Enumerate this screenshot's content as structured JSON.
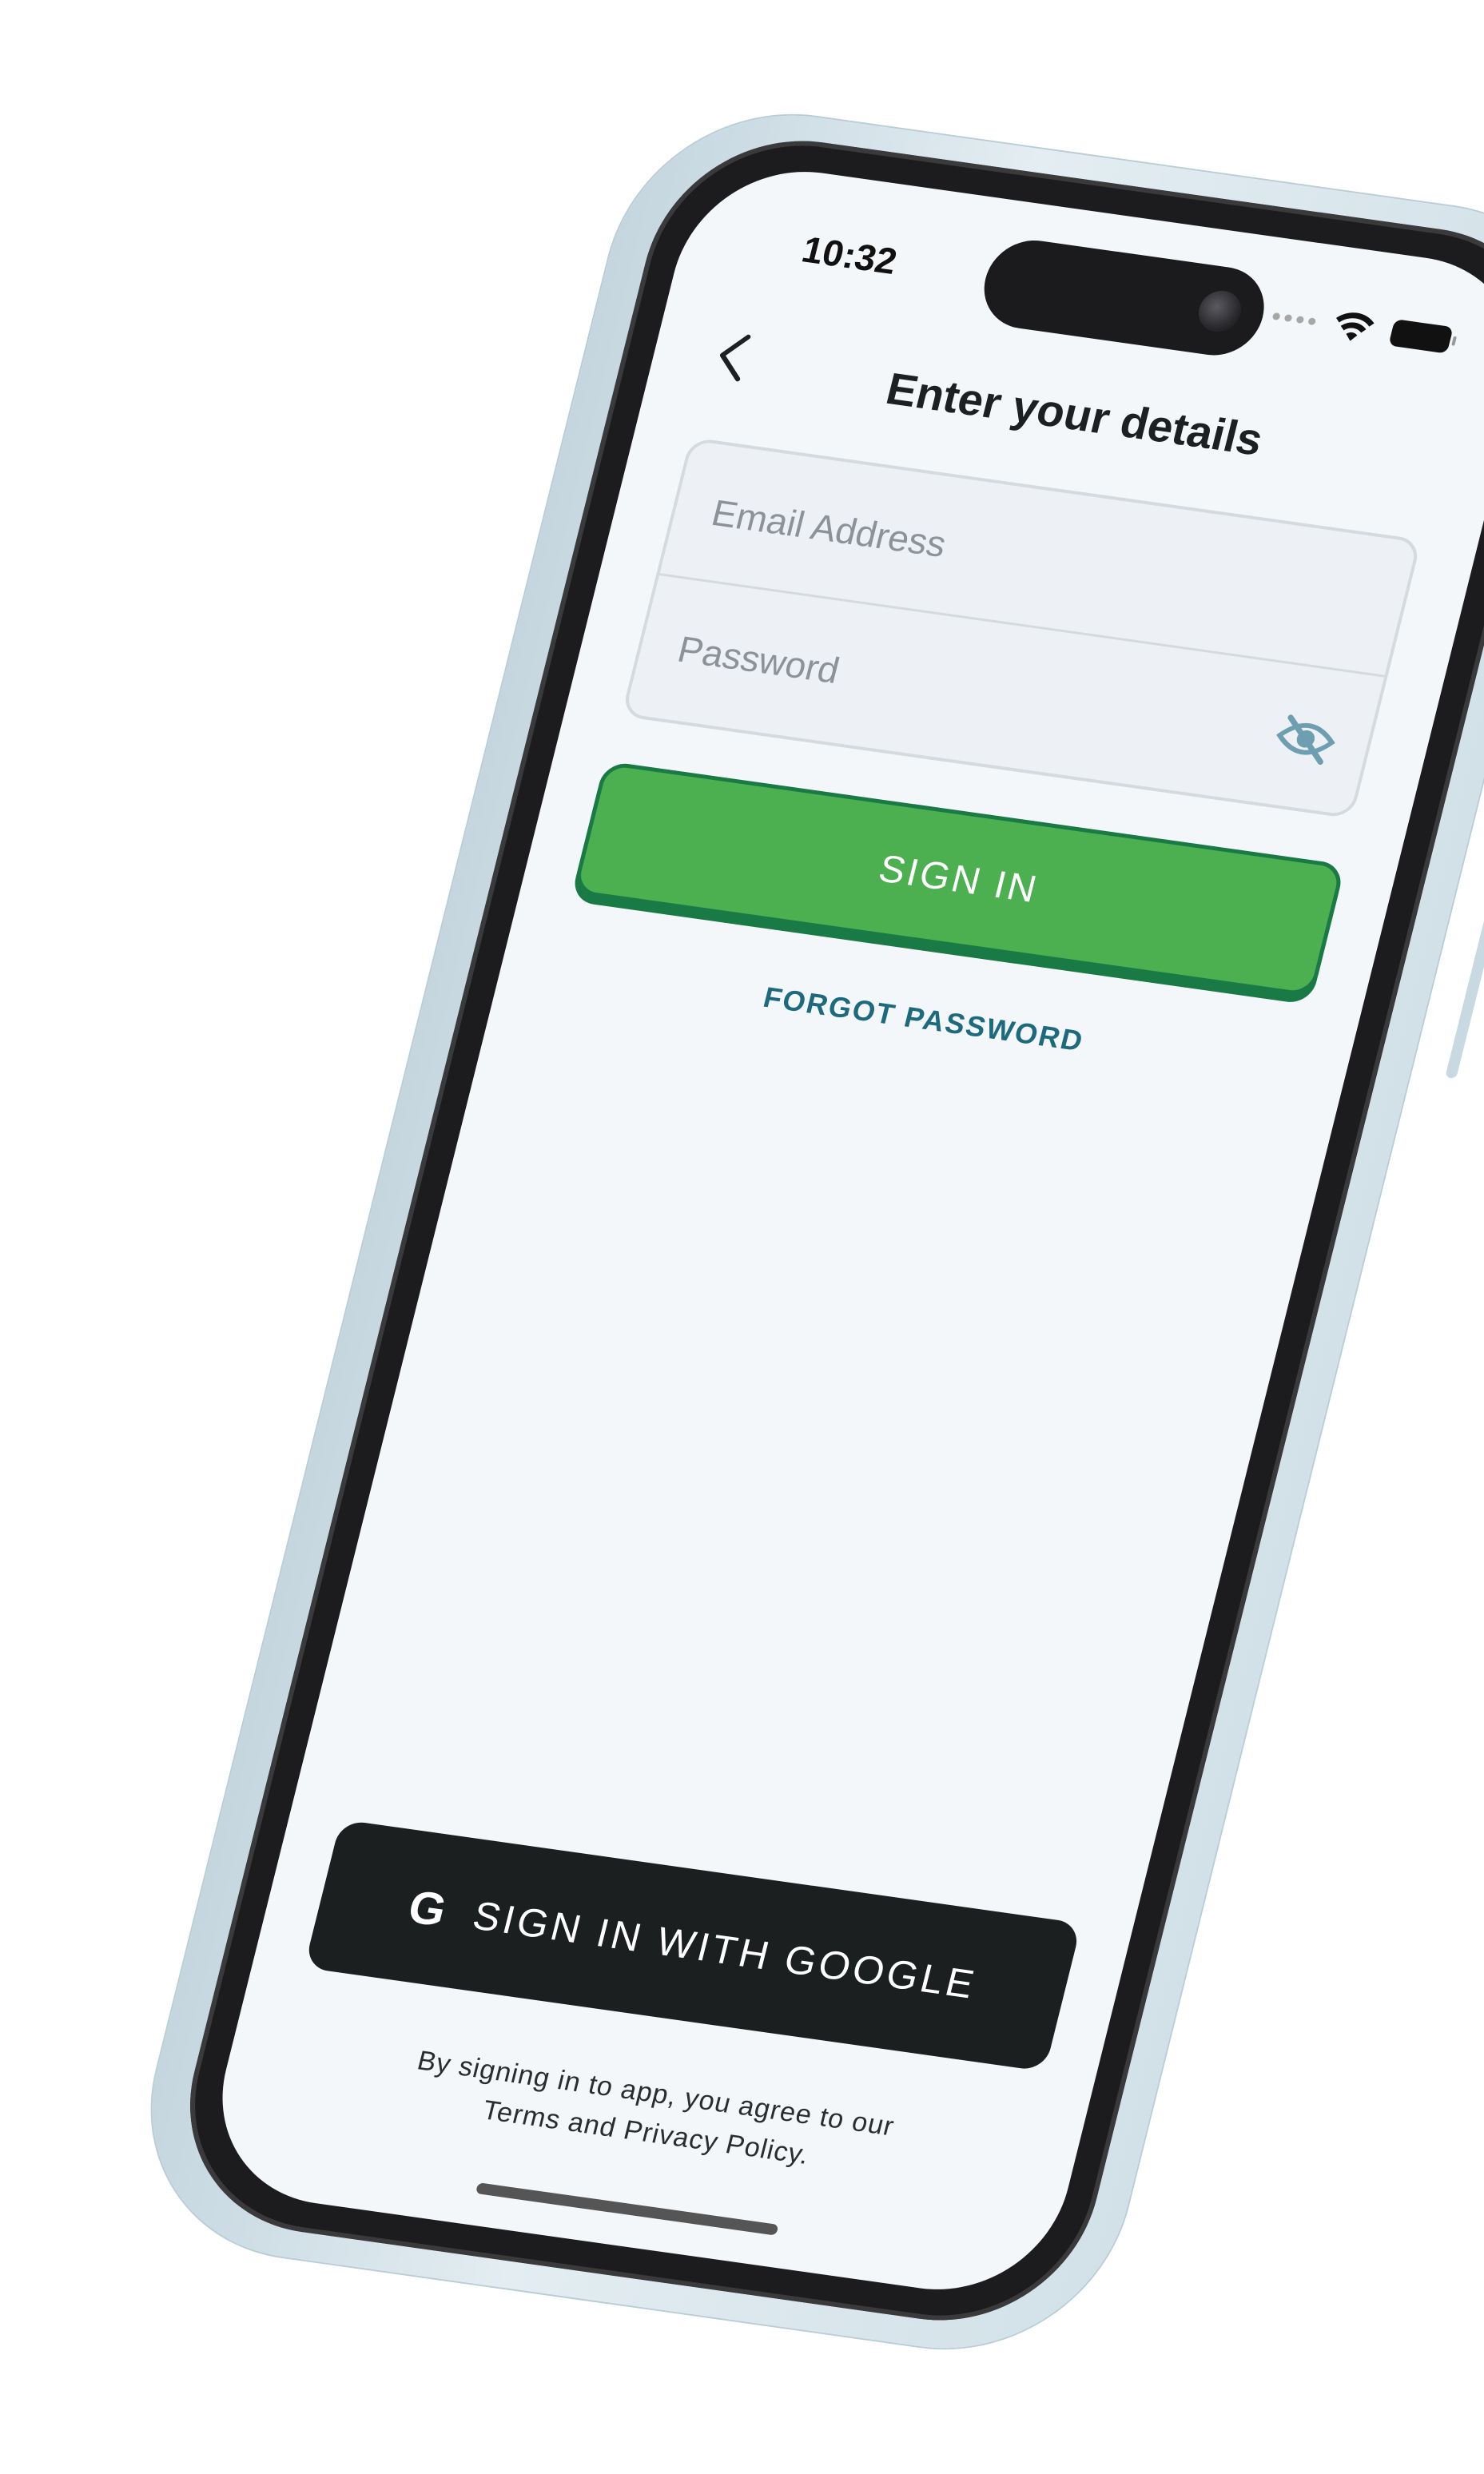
{
  "status_bar": {
    "time": "10:32",
    "icons": [
      "cellular-dots-icon",
      "wifi-icon",
      "battery-icon"
    ]
  },
  "header": {
    "back_icon": "chevron-left-icon",
    "title": "Enter your details"
  },
  "form": {
    "email_placeholder": "Email Address",
    "password_placeholder": "Password",
    "password_toggle_icon": "eye-off-icon"
  },
  "actions": {
    "sign_in_label": "SIGN IN",
    "forgot_password_label": "FORGOT PASSWORD",
    "google_icon": "google-g-icon",
    "google_g_glyph": "G",
    "google_label": "SIGN IN WITH GOOGLE"
  },
  "legal": {
    "line1": "By signing in to app, you agree to our",
    "line2": "Terms and Privacy Policy."
  },
  "colors": {
    "primary_green": "#4caf50",
    "green_border": "#1a7a45",
    "link_teal": "#1d6a7e",
    "google_button_bg": "#1b1f20",
    "screen_bg": "#f4f7fa"
  }
}
